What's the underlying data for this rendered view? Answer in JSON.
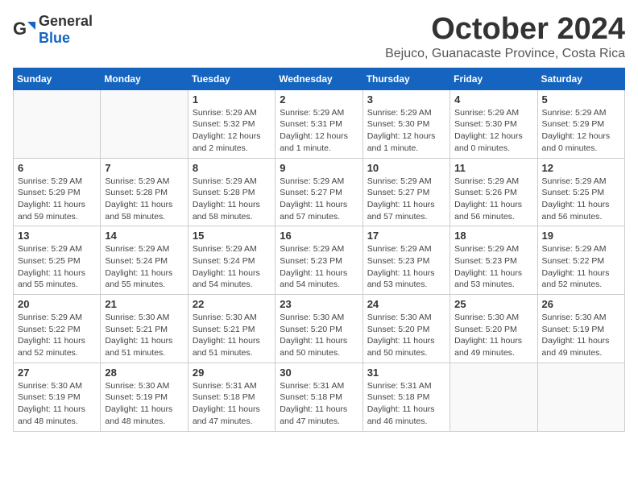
{
  "logo": {
    "general": "General",
    "blue": "Blue"
  },
  "title": "October 2024",
  "location": "Bejuco, Guanacaste Province, Costa Rica",
  "days_header": [
    "Sunday",
    "Monday",
    "Tuesday",
    "Wednesday",
    "Thursday",
    "Friday",
    "Saturday"
  ],
  "weeks": [
    [
      {
        "day": "",
        "info": ""
      },
      {
        "day": "",
        "info": ""
      },
      {
        "day": "1",
        "info": "Sunrise: 5:29 AM\nSunset: 5:32 PM\nDaylight: 12 hours\nand 2 minutes."
      },
      {
        "day": "2",
        "info": "Sunrise: 5:29 AM\nSunset: 5:31 PM\nDaylight: 12 hours\nand 1 minute."
      },
      {
        "day": "3",
        "info": "Sunrise: 5:29 AM\nSunset: 5:30 PM\nDaylight: 12 hours\nand 1 minute."
      },
      {
        "day": "4",
        "info": "Sunrise: 5:29 AM\nSunset: 5:30 PM\nDaylight: 12 hours\nand 0 minutes."
      },
      {
        "day": "5",
        "info": "Sunrise: 5:29 AM\nSunset: 5:29 PM\nDaylight: 12 hours\nand 0 minutes."
      }
    ],
    [
      {
        "day": "6",
        "info": "Sunrise: 5:29 AM\nSunset: 5:29 PM\nDaylight: 11 hours\nand 59 minutes."
      },
      {
        "day": "7",
        "info": "Sunrise: 5:29 AM\nSunset: 5:28 PM\nDaylight: 11 hours\nand 58 minutes."
      },
      {
        "day": "8",
        "info": "Sunrise: 5:29 AM\nSunset: 5:28 PM\nDaylight: 11 hours\nand 58 minutes."
      },
      {
        "day": "9",
        "info": "Sunrise: 5:29 AM\nSunset: 5:27 PM\nDaylight: 11 hours\nand 57 minutes."
      },
      {
        "day": "10",
        "info": "Sunrise: 5:29 AM\nSunset: 5:27 PM\nDaylight: 11 hours\nand 57 minutes."
      },
      {
        "day": "11",
        "info": "Sunrise: 5:29 AM\nSunset: 5:26 PM\nDaylight: 11 hours\nand 56 minutes."
      },
      {
        "day": "12",
        "info": "Sunrise: 5:29 AM\nSunset: 5:25 PM\nDaylight: 11 hours\nand 56 minutes."
      }
    ],
    [
      {
        "day": "13",
        "info": "Sunrise: 5:29 AM\nSunset: 5:25 PM\nDaylight: 11 hours\nand 55 minutes."
      },
      {
        "day": "14",
        "info": "Sunrise: 5:29 AM\nSunset: 5:24 PM\nDaylight: 11 hours\nand 55 minutes."
      },
      {
        "day": "15",
        "info": "Sunrise: 5:29 AM\nSunset: 5:24 PM\nDaylight: 11 hours\nand 54 minutes."
      },
      {
        "day": "16",
        "info": "Sunrise: 5:29 AM\nSunset: 5:23 PM\nDaylight: 11 hours\nand 54 minutes."
      },
      {
        "day": "17",
        "info": "Sunrise: 5:29 AM\nSunset: 5:23 PM\nDaylight: 11 hours\nand 53 minutes."
      },
      {
        "day": "18",
        "info": "Sunrise: 5:29 AM\nSunset: 5:23 PM\nDaylight: 11 hours\nand 53 minutes."
      },
      {
        "day": "19",
        "info": "Sunrise: 5:29 AM\nSunset: 5:22 PM\nDaylight: 11 hours\nand 52 minutes."
      }
    ],
    [
      {
        "day": "20",
        "info": "Sunrise: 5:29 AM\nSunset: 5:22 PM\nDaylight: 11 hours\nand 52 minutes."
      },
      {
        "day": "21",
        "info": "Sunrise: 5:30 AM\nSunset: 5:21 PM\nDaylight: 11 hours\nand 51 minutes."
      },
      {
        "day": "22",
        "info": "Sunrise: 5:30 AM\nSunset: 5:21 PM\nDaylight: 11 hours\nand 51 minutes."
      },
      {
        "day": "23",
        "info": "Sunrise: 5:30 AM\nSunset: 5:20 PM\nDaylight: 11 hours\nand 50 minutes."
      },
      {
        "day": "24",
        "info": "Sunrise: 5:30 AM\nSunset: 5:20 PM\nDaylight: 11 hours\nand 50 minutes."
      },
      {
        "day": "25",
        "info": "Sunrise: 5:30 AM\nSunset: 5:20 PM\nDaylight: 11 hours\nand 49 minutes."
      },
      {
        "day": "26",
        "info": "Sunrise: 5:30 AM\nSunset: 5:19 PM\nDaylight: 11 hours\nand 49 minutes."
      }
    ],
    [
      {
        "day": "27",
        "info": "Sunrise: 5:30 AM\nSunset: 5:19 PM\nDaylight: 11 hours\nand 48 minutes."
      },
      {
        "day": "28",
        "info": "Sunrise: 5:30 AM\nSunset: 5:19 PM\nDaylight: 11 hours\nand 48 minutes."
      },
      {
        "day": "29",
        "info": "Sunrise: 5:31 AM\nSunset: 5:18 PM\nDaylight: 11 hours\nand 47 minutes."
      },
      {
        "day": "30",
        "info": "Sunrise: 5:31 AM\nSunset: 5:18 PM\nDaylight: 11 hours\nand 47 minutes."
      },
      {
        "day": "31",
        "info": "Sunrise: 5:31 AM\nSunset: 5:18 PM\nDaylight: 11 hours\nand 46 minutes."
      },
      {
        "day": "",
        "info": ""
      },
      {
        "day": "",
        "info": ""
      }
    ]
  ]
}
